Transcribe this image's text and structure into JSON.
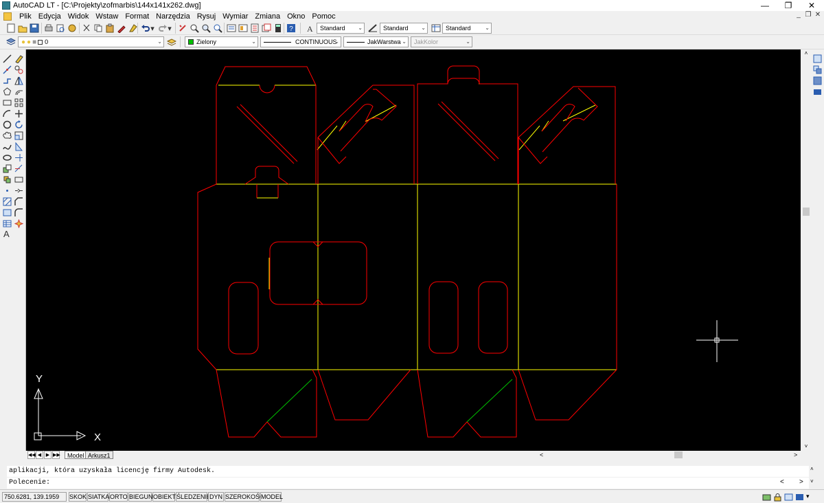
{
  "window": {
    "title": "AutoCAD LT - [C:\\Projekty\\zofmarbis\\144x141x262.dwg]"
  },
  "menu": [
    "Plik",
    "Edycja",
    "Widok",
    "Wstaw",
    "Format",
    "Narzędzia",
    "Rysuj",
    "Wymiar",
    "Zmiana",
    "Okno",
    "Pomoc"
  ],
  "styles": {
    "text_style": "Standard",
    "dim_style": "Standard",
    "table_style": "Standard"
  },
  "layer": {
    "current": "0"
  },
  "properties": {
    "color": "Zielony",
    "linetype": "CONTINUOUS",
    "lineweight": "JakWarstwa",
    "plotstyle": "JakKolor"
  },
  "tabs": [
    "Model",
    "Arkusz1"
  ],
  "command": {
    "history": "aplikacji, która uzyskała licencję firmy Autodesk.",
    "prompt": "Polecenie:"
  },
  "status": {
    "coords": "750.6281, 139.1959",
    "buttons": [
      "SKOK",
      "SIATKA",
      "ORTO",
      "BIEGUN",
      "OBIEKT",
      "ŚLEDZENIE",
      "DYN",
      "SZEROKOŚĆ",
      "MODEL"
    ]
  },
  "ucs": {
    "x_label": "X",
    "y_label": "Y"
  },
  "colors": {
    "canvas": "#000000",
    "cut_line": "#ff0000",
    "fold_line": "#ffff00",
    "crease_line": "#00c000",
    "crosshair": "#ffffff"
  }
}
